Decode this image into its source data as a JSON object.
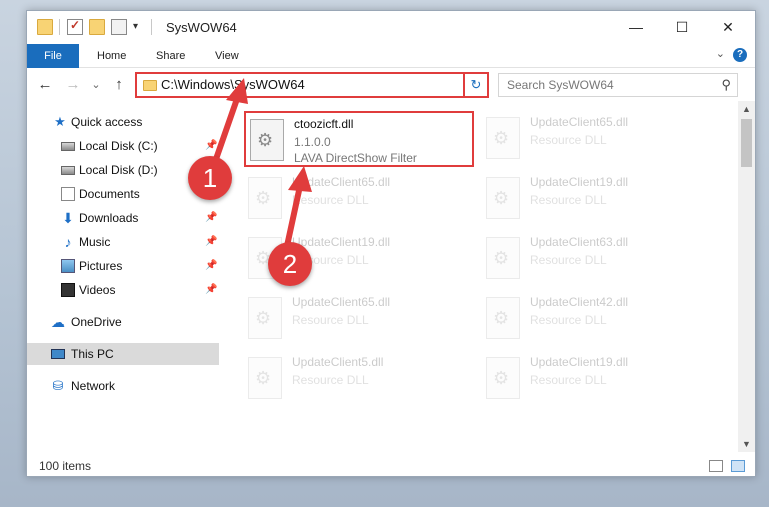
{
  "window": {
    "title": "SysWOW64",
    "controls": {
      "minimize": "—",
      "maximize": "☐",
      "close": "✕"
    }
  },
  "quick_access_icons": [
    "folder-icon",
    "properties-icon",
    "new-folder-icon",
    "customize-icon"
  ],
  "ribbon": {
    "tabs": [
      "File",
      "Home",
      "Share",
      "View"
    ],
    "collapse": "⌄",
    "help": "?"
  },
  "nav": {
    "back": "←",
    "forward": "→",
    "recent": "⌄",
    "up": "↑",
    "address": "C:\\Windows\\SysWOW64",
    "address_dropdown": "⌄",
    "refresh": "↻",
    "search_placeholder": "Search SysWOW64",
    "search_icon": "⚲"
  },
  "sidebar": {
    "items": [
      {
        "label": "Quick access",
        "icon": "star-icon",
        "glyph": "★"
      },
      {
        "label": "Local Disk (C:)",
        "icon": "drive-icon",
        "pinned": true
      },
      {
        "label": "Local Disk (D:)",
        "icon": "drive-icon"
      },
      {
        "label": "Documents",
        "icon": "documents-icon"
      },
      {
        "label": "Downloads",
        "icon": "download-icon",
        "glyph": "⬇",
        "pinned": true
      },
      {
        "label": "Music",
        "icon": "music-icon",
        "glyph": "♪",
        "pinned": true
      },
      {
        "label": "Pictures",
        "icon": "pictures-icon",
        "pinned": true
      },
      {
        "label": "Videos",
        "icon": "videos-icon",
        "pinned": true
      },
      {
        "label": "OneDrive",
        "icon": "cloud-icon",
        "glyph": "☁"
      },
      {
        "label": "This PC",
        "icon": "computer-icon",
        "selected": true
      },
      {
        "label": "Network",
        "icon": "network-icon",
        "glyph": "⛁"
      }
    ],
    "pin_glyph": "📌"
  },
  "files": [
    {
      "name": "ctoozicft.dll",
      "line2": "1.1.0.0",
      "line3": "LAVA DirectShow Filter",
      "highlight": true
    },
    {
      "name": "UpdateClient65.dll",
      "line2": "Resource DLL"
    },
    {
      "name": "UpdateClient65.dll",
      "line2": "Resource DLL"
    },
    {
      "name": "UpdateClient19.dll",
      "line2": "Resource DLL"
    },
    {
      "name": "UpdateClient19.dll",
      "line2": "Resource DLL"
    },
    {
      "name": "UpdateClient63.dll",
      "line2": "Resource DLL"
    },
    {
      "name": "UpdateClient65.dll",
      "line2": "Resource DLL"
    },
    {
      "name": "UpdateClient42.dll",
      "line2": "Resource DLL"
    },
    {
      "name": "UpdateClient5.dll",
      "line2": "Resource DLL"
    },
    {
      "name": "UpdateClient19.dll",
      "line2": "Resource DLL"
    }
  ],
  "scrollbar": {
    "up": "▲",
    "down": "▼"
  },
  "status": {
    "item_count": "100 items"
  },
  "annotations": {
    "badge1": "1",
    "badge2": "2",
    "color": "#e03c3c"
  }
}
